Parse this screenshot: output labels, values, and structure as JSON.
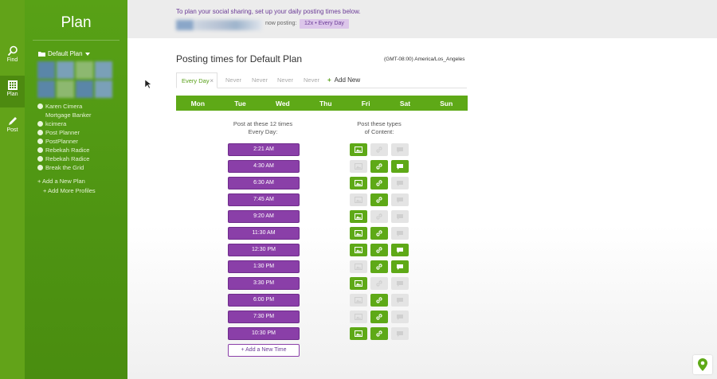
{
  "colors": {
    "brand_green": "#5ea917",
    "purple": "#8a3fa8",
    "disabled_gray": "#e4e4e4"
  },
  "rail": {
    "items": [
      {
        "label": "Find",
        "icon": "search-icon",
        "active": false
      },
      {
        "label": "Plan",
        "icon": "calendar-icon",
        "active": true
      },
      {
        "label": "Post",
        "icon": "pencil-icon",
        "active": false
      }
    ]
  },
  "sidebar": {
    "title": "Plan",
    "plan_select": "Default Plan",
    "profiles": [
      "Karen Cimera Mortgage Banker",
      "kcimera",
      "Post Planner",
      "PostPlanner",
      "Rebekah Radice",
      "Rebekah Radice",
      "Break the Grid"
    ],
    "add_plan": "+ Add a New Plan",
    "add_profiles": "+ Add More Profiles"
  },
  "banner": {
    "message": "To plan your social sharing, set up your daily posting times below.",
    "now_posting_label": "now posting:",
    "now_posting_value": "12x • Every Day"
  },
  "main": {
    "heading": "Posting times for Default Plan",
    "timezone": "(GMT-08:00) America/Los_Angeles",
    "tabs": [
      "Every Day",
      "Never",
      "Never",
      "Never",
      "Never"
    ],
    "tab_close": "×",
    "add_new": "Add New",
    "days": [
      "Mon",
      "Tue",
      "Wed",
      "Thu",
      "Fri",
      "Sat",
      "Sun"
    ],
    "times_label_1": "Post at these 12 times",
    "times_label_2": "Every Day:",
    "types_label_1": "Post these types",
    "types_label_2": "of Content:",
    "times": [
      "2:21 AM",
      "4:30 AM",
      "6:30 AM",
      "7:45 AM",
      "9:20 AM",
      "11:30 AM",
      "12:30 PM",
      "1:30 PM",
      "3:30 PM",
      "6:00 PM",
      "7:30 PM",
      "10:30 PM"
    ],
    "content_types": [
      [
        true,
        false,
        false
      ],
      [
        false,
        true,
        true
      ],
      [
        true,
        true,
        false
      ],
      [
        false,
        true,
        false
      ],
      [
        true,
        false,
        false
      ],
      [
        true,
        true,
        false
      ],
      [
        true,
        true,
        true
      ],
      [
        false,
        true,
        true
      ],
      [
        true,
        false,
        false
      ],
      [
        false,
        true,
        false
      ],
      [
        false,
        true,
        false
      ],
      [
        true,
        true,
        false
      ]
    ],
    "add_time": "+ Add a New Time"
  }
}
